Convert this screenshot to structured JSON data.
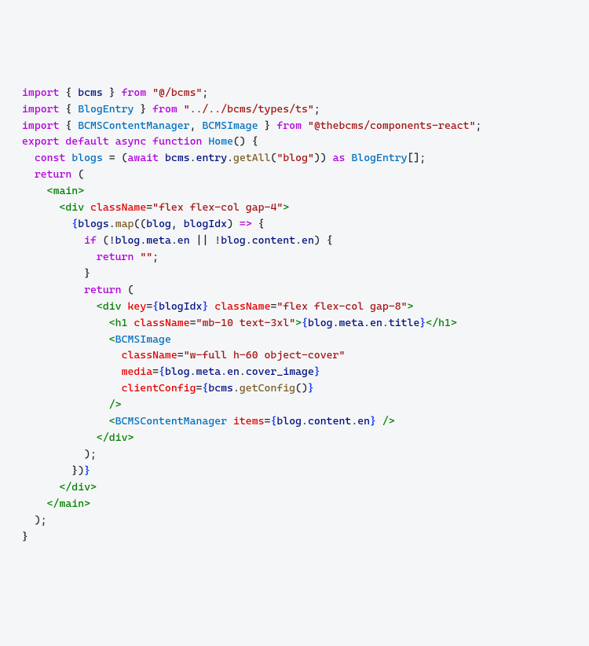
{
  "code": {
    "line1": {
      "t1": "import",
      "t2": " { ",
      "t3": "bcms",
      "t4": " } ",
      "t5": "from",
      "t6": " ",
      "t7": "\"@/bcms\"",
      "t8": ";"
    },
    "line2": {
      "t1": "import",
      "t2": " { ",
      "t3": "BlogEntry",
      "t4": " } ",
      "t5": "from",
      "t6": " ",
      "t7": "\"../../bcms/types/ts\"",
      "t8": ";"
    },
    "line3": {
      "t1": "import",
      "t2": " { ",
      "t3": "BCMSContentManager",
      "t4": ", ",
      "t5": "BCMSImage",
      "t6": " } ",
      "t7": "from",
      "t8": " ",
      "t9": "\"@thebcms/components-react\"",
      "t10": ";"
    },
    "line4": {
      "t1": "export",
      "t2": " ",
      "t3": "default",
      "t4": " ",
      "t5": "async",
      "t6": " ",
      "t7": "function",
      "t8": " ",
      "t9": "Home",
      "t10": "() {"
    },
    "line5": {
      "t1": "  ",
      "t2": "const",
      "t3": " ",
      "t4": "blogs",
      "t5": " = (",
      "t6": "await",
      "t7": " ",
      "t8": "bcms",
      "t9": ".",
      "t10": "entry",
      "t11": ".",
      "t12": "getAll",
      "t13": "(",
      "t14": "\"blog\"",
      "t15": ")) ",
      "t16": "as",
      "t17": " ",
      "t18": "BlogEntry",
      "t19": "[];"
    },
    "line6": {
      "t1": "  ",
      "t2": "return",
      "t3": " ("
    },
    "line7": {
      "t1": "    ",
      "t2": "<",
      "t3": "main",
      "t4": ">"
    },
    "line8": {
      "t1": "      ",
      "t2": "<",
      "t3": "div",
      "t4": " ",
      "t5": "className",
      "t6": "=",
      "t7": "\"flex flex-col gap-4\"",
      "t8": ">"
    },
    "line9": {
      "t1": "        ",
      "t2": "{",
      "t3": "blogs",
      "t4": ".",
      "t5": "map",
      "t6": "((",
      "t7": "blog",
      "t8": ", ",
      "t9": "blogIdx",
      "t10": ") ",
      "t11": "=>",
      "t12": " {"
    },
    "line10": {
      "t1": "          ",
      "t2": "if",
      "t3": " (!",
      "t4": "blog",
      "t5": ".",
      "t6": "meta",
      "t7": ".",
      "t8": "en",
      "t9": " || !",
      "t10": "blog",
      "t11": ".",
      "t12": "content",
      "t13": ".",
      "t14": "en",
      "t15": ") {"
    },
    "line11": {
      "t1": "            ",
      "t2": "return",
      "t3": " ",
      "t4": "\"\"",
      "t5": ";"
    },
    "line12": {
      "t1": "          }"
    },
    "line13": {
      "t1": "          ",
      "t2": "return",
      "t3": " ("
    },
    "line14": {
      "t1": "            ",
      "t2": "<",
      "t3": "div",
      "t4": " ",
      "t5": "key",
      "t6": "=",
      "t7": "{",
      "t8": "blogIdx",
      "t9": "}",
      "t10": " ",
      "t11": "className",
      "t12": "=",
      "t13": "\"flex flex-col gap-8\"",
      "t14": ">"
    },
    "line15": {
      "t1": "              ",
      "t2": "<",
      "t3": "h1",
      "t4": " ",
      "t5": "className",
      "t6": "=",
      "t7": "\"mb-10 text-3xl\"",
      "t8": ">",
      "t9": "{",
      "t10": "blog",
      "t11": ".",
      "t12": "meta",
      "t13": ".",
      "t14": "en",
      "t15": ".",
      "t16": "title",
      "t17": "}",
      "t18": "</",
      "t19": "h1",
      "t20": ">"
    },
    "line16": {
      "t1": "              ",
      "t2": "<",
      "t3": "BCMSImage"
    },
    "line17": {
      "t1": "                ",
      "t2": "className",
      "t3": "=",
      "t4": "\"w-full h-60 object-cover\""
    },
    "line18": {
      "t1": "                ",
      "t2": "media",
      "t3": "=",
      "t4": "{",
      "t5": "blog",
      "t6": ".",
      "t7": "meta",
      "t8": ".",
      "t9": "en",
      "t10": ".",
      "t11": "cover_image",
      "t12": "}"
    },
    "line19": {
      "t1": "                ",
      "t2": "clientConfig",
      "t3": "=",
      "t4": "{",
      "t5": "bcms",
      "t6": ".",
      "t7": "getConfig",
      "t8": "()",
      "t9": "}"
    },
    "line20": {
      "t1": "              ",
      "t2": "/>"
    },
    "line21": {
      "t1": "              ",
      "t2": "<",
      "t3": "BCMSContentManager",
      "t4": " ",
      "t5": "items",
      "t6": "=",
      "t7": "{",
      "t8": "blog",
      "t9": ".",
      "t10": "content",
      "t11": ".",
      "t12": "en",
      "t13": "}",
      "t14": " ",
      "t15": "/>"
    },
    "line22": {
      "t1": "            ",
      "t2": "</",
      "t3": "div",
      "t4": ">"
    },
    "line23": {
      "t1": "          );"
    },
    "line24": {
      "t1": "        })",
      "t2": "}"
    },
    "line25": {
      "t1": "      ",
      "t2": "</",
      "t3": "div",
      "t4": ">"
    },
    "line26": {
      "t1": "    ",
      "t2": "</",
      "t3": "main",
      "t4": ">"
    },
    "line27": {
      "t1": "  );"
    },
    "line28": {
      "t1": "}"
    }
  }
}
